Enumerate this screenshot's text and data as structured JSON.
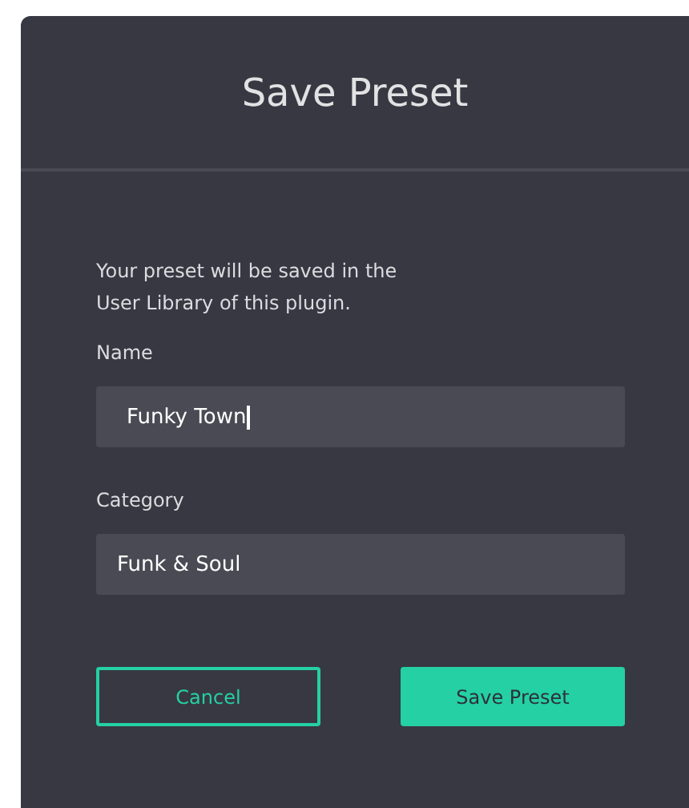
{
  "dialog": {
    "title": "Save Preset",
    "message": "Your preset will be saved in the\nUser Library of this plugin.",
    "fields": [
      {
        "label": "Name",
        "value": "Funky Town",
        "focused": true
      },
      {
        "label": "Category",
        "value": "Funk & Soul",
        "focused": false
      }
    ],
    "buttons": [
      {
        "label": "Cancel",
        "kind": "secondary"
      },
      {
        "label": "Save Preset",
        "kind": "primary"
      }
    ]
  }
}
